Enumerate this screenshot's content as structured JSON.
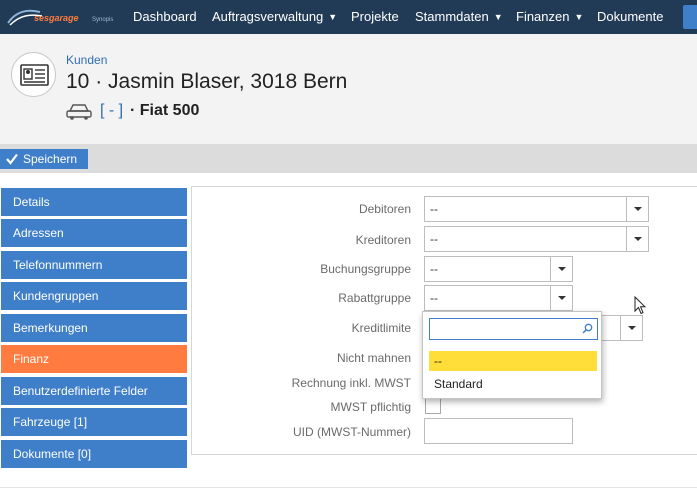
{
  "brand": {
    "logo_text": "sesgarage",
    "logo_sub": "Synopis"
  },
  "nav": {
    "items": [
      {
        "label": "Dashboard",
        "has_caret": false
      },
      {
        "label": "Auftragsverwaltung",
        "has_caret": true
      },
      {
        "label": "Projekte",
        "has_caret": false
      },
      {
        "label": "Stammdaten",
        "has_caret": true
      },
      {
        "label": "Finanzen",
        "has_caret": true
      },
      {
        "label": "Dokumente",
        "has_caret": false
      }
    ],
    "caret": "▼"
  },
  "header": {
    "breadcrumb": "Kunden",
    "title": "10 · Jasmin Blaser, 3018 Bern",
    "vehicle_link": "[ - ]",
    "vehicle_name": "· Fiat 500"
  },
  "toolbar": {
    "save_label": "Speichern"
  },
  "sidebar": {
    "items": [
      {
        "label": "Details",
        "active": false
      },
      {
        "label": "Adressen",
        "active": false
      },
      {
        "label": "Telefonnummern",
        "active": false
      },
      {
        "label": "Kundengruppen",
        "active": false
      },
      {
        "label": "Bemerkungen",
        "active": false
      },
      {
        "label": "Finanz",
        "active": true
      },
      {
        "label": "Benutzerdefinierte Felder",
        "active": false
      },
      {
        "label": "Fahrzeuge [1]",
        "active": false
      },
      {
        "label": "Dokumente [0]",
        "active": false
      }
    ]
  },
  "form": {
    "debitoren": {
      "label": "Debitoren",
      "value": "--"
    },
    "kreditoren": {
      "label": "Kreditoren",
      "value": "--"
    },
    "buchungsgruppe": {
      "label": "Buchungsgruppe",
      "value": "--"
    },
    "rabattgruppe": {
      "label": "Rabattgruppe",
      "value": "--"
    },
    "kreditlimite": {
      "label": "Kreditlimite"
    },
    "nicht_mahnen": {
      "label": "Nicht mahnen"
    },
    "rechnung_mwst": {
      "label": "Rechnung inkl. MWST"
    },
    "mwst_pflichtig": {
      "label": "MWST pflichtig"
    },
    "uid": {
      "label": "UID (MWST-Nummer)",
      "value": ""
    }
  },
  "dropdown": {
    "search_value": "",
    "options": [
      {
        "label": "--",
        "highlighted": true
      },
      {
        "label": "Standard",
        "highlighted": false
      }
    ]
  },
  "colors": {
    "nav_bg": "#213b56",
    "accent": "#3f7fc9",
    "active_tab": "#ff7b3f",
    "highlight": "#ffde3a"
  }
}
